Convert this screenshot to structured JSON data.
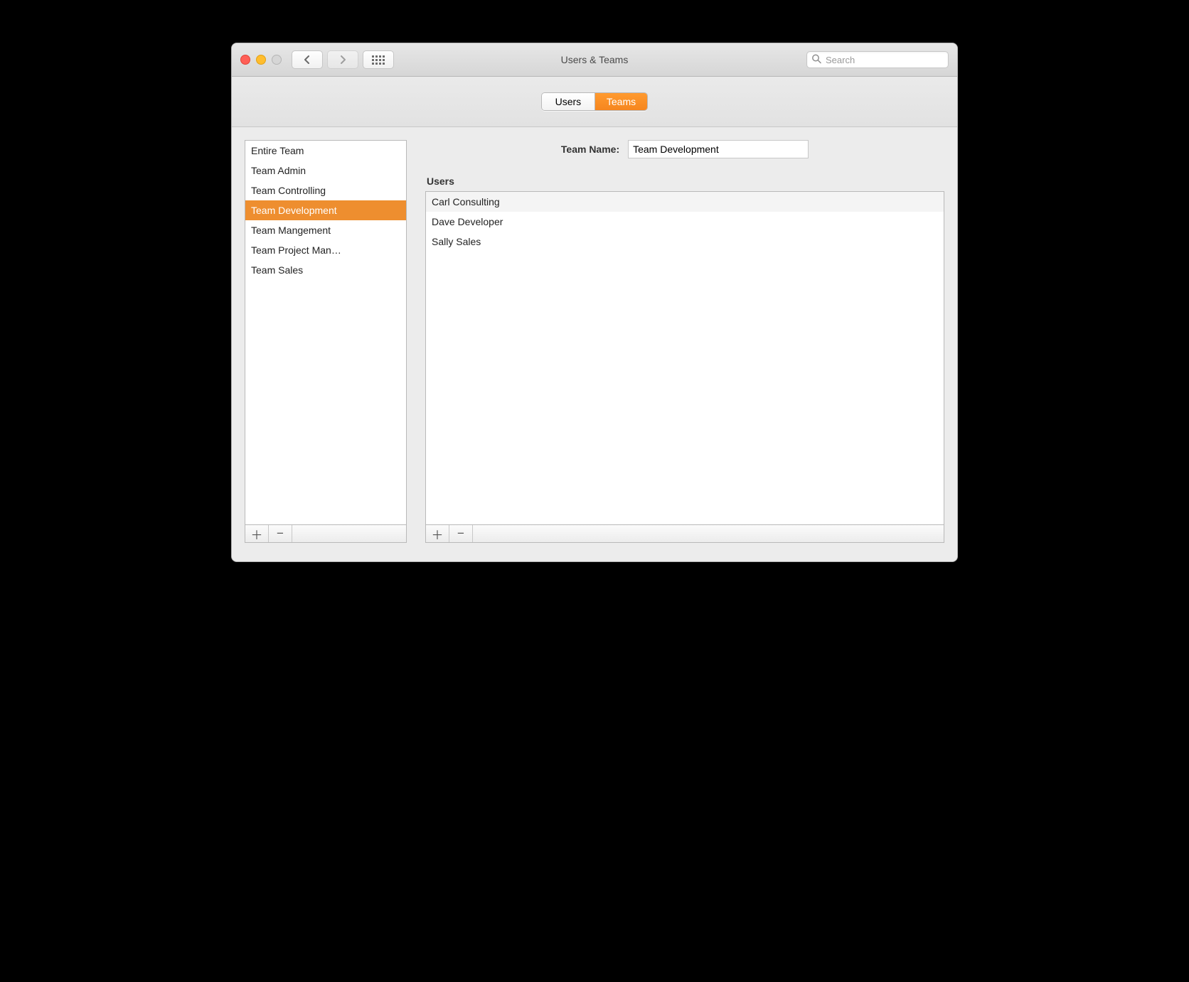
{
  "window": {
    "title": "Users & Teams",
    "search_placeholder": "Search"
  },
  "tabs": [
    {
      "label": "Users",
      "active": false
    },
    {
      "label": "Teams",
      "active": true
    }
  ],
  "teams_list": {
    "items": [
      {
        "label": "Entire Team"
      },
      {
        "label": "Team Admin"
      },
      {
        "label": "Team Controlling"
      },
      {
        "label": "Team Development",
        "selected": true
      },
      {
        "label": "Team Mangement"
      },
      {
        "label": "Team Project Man…"
      },
      {
        "label": "Team Sales"
      }
    ]
  },
  "detail": {
    "team_name_label": "Team Name:",
    "team_name_value": "Team Development",
    "users_heading": "Users",
    "users": [
      {
        "label": "Carl Consulting"
      },
      {
        "label": "Dave Developer"
      },
      {
        "label": "Sally Sales"
      }
    ]
  }
}
